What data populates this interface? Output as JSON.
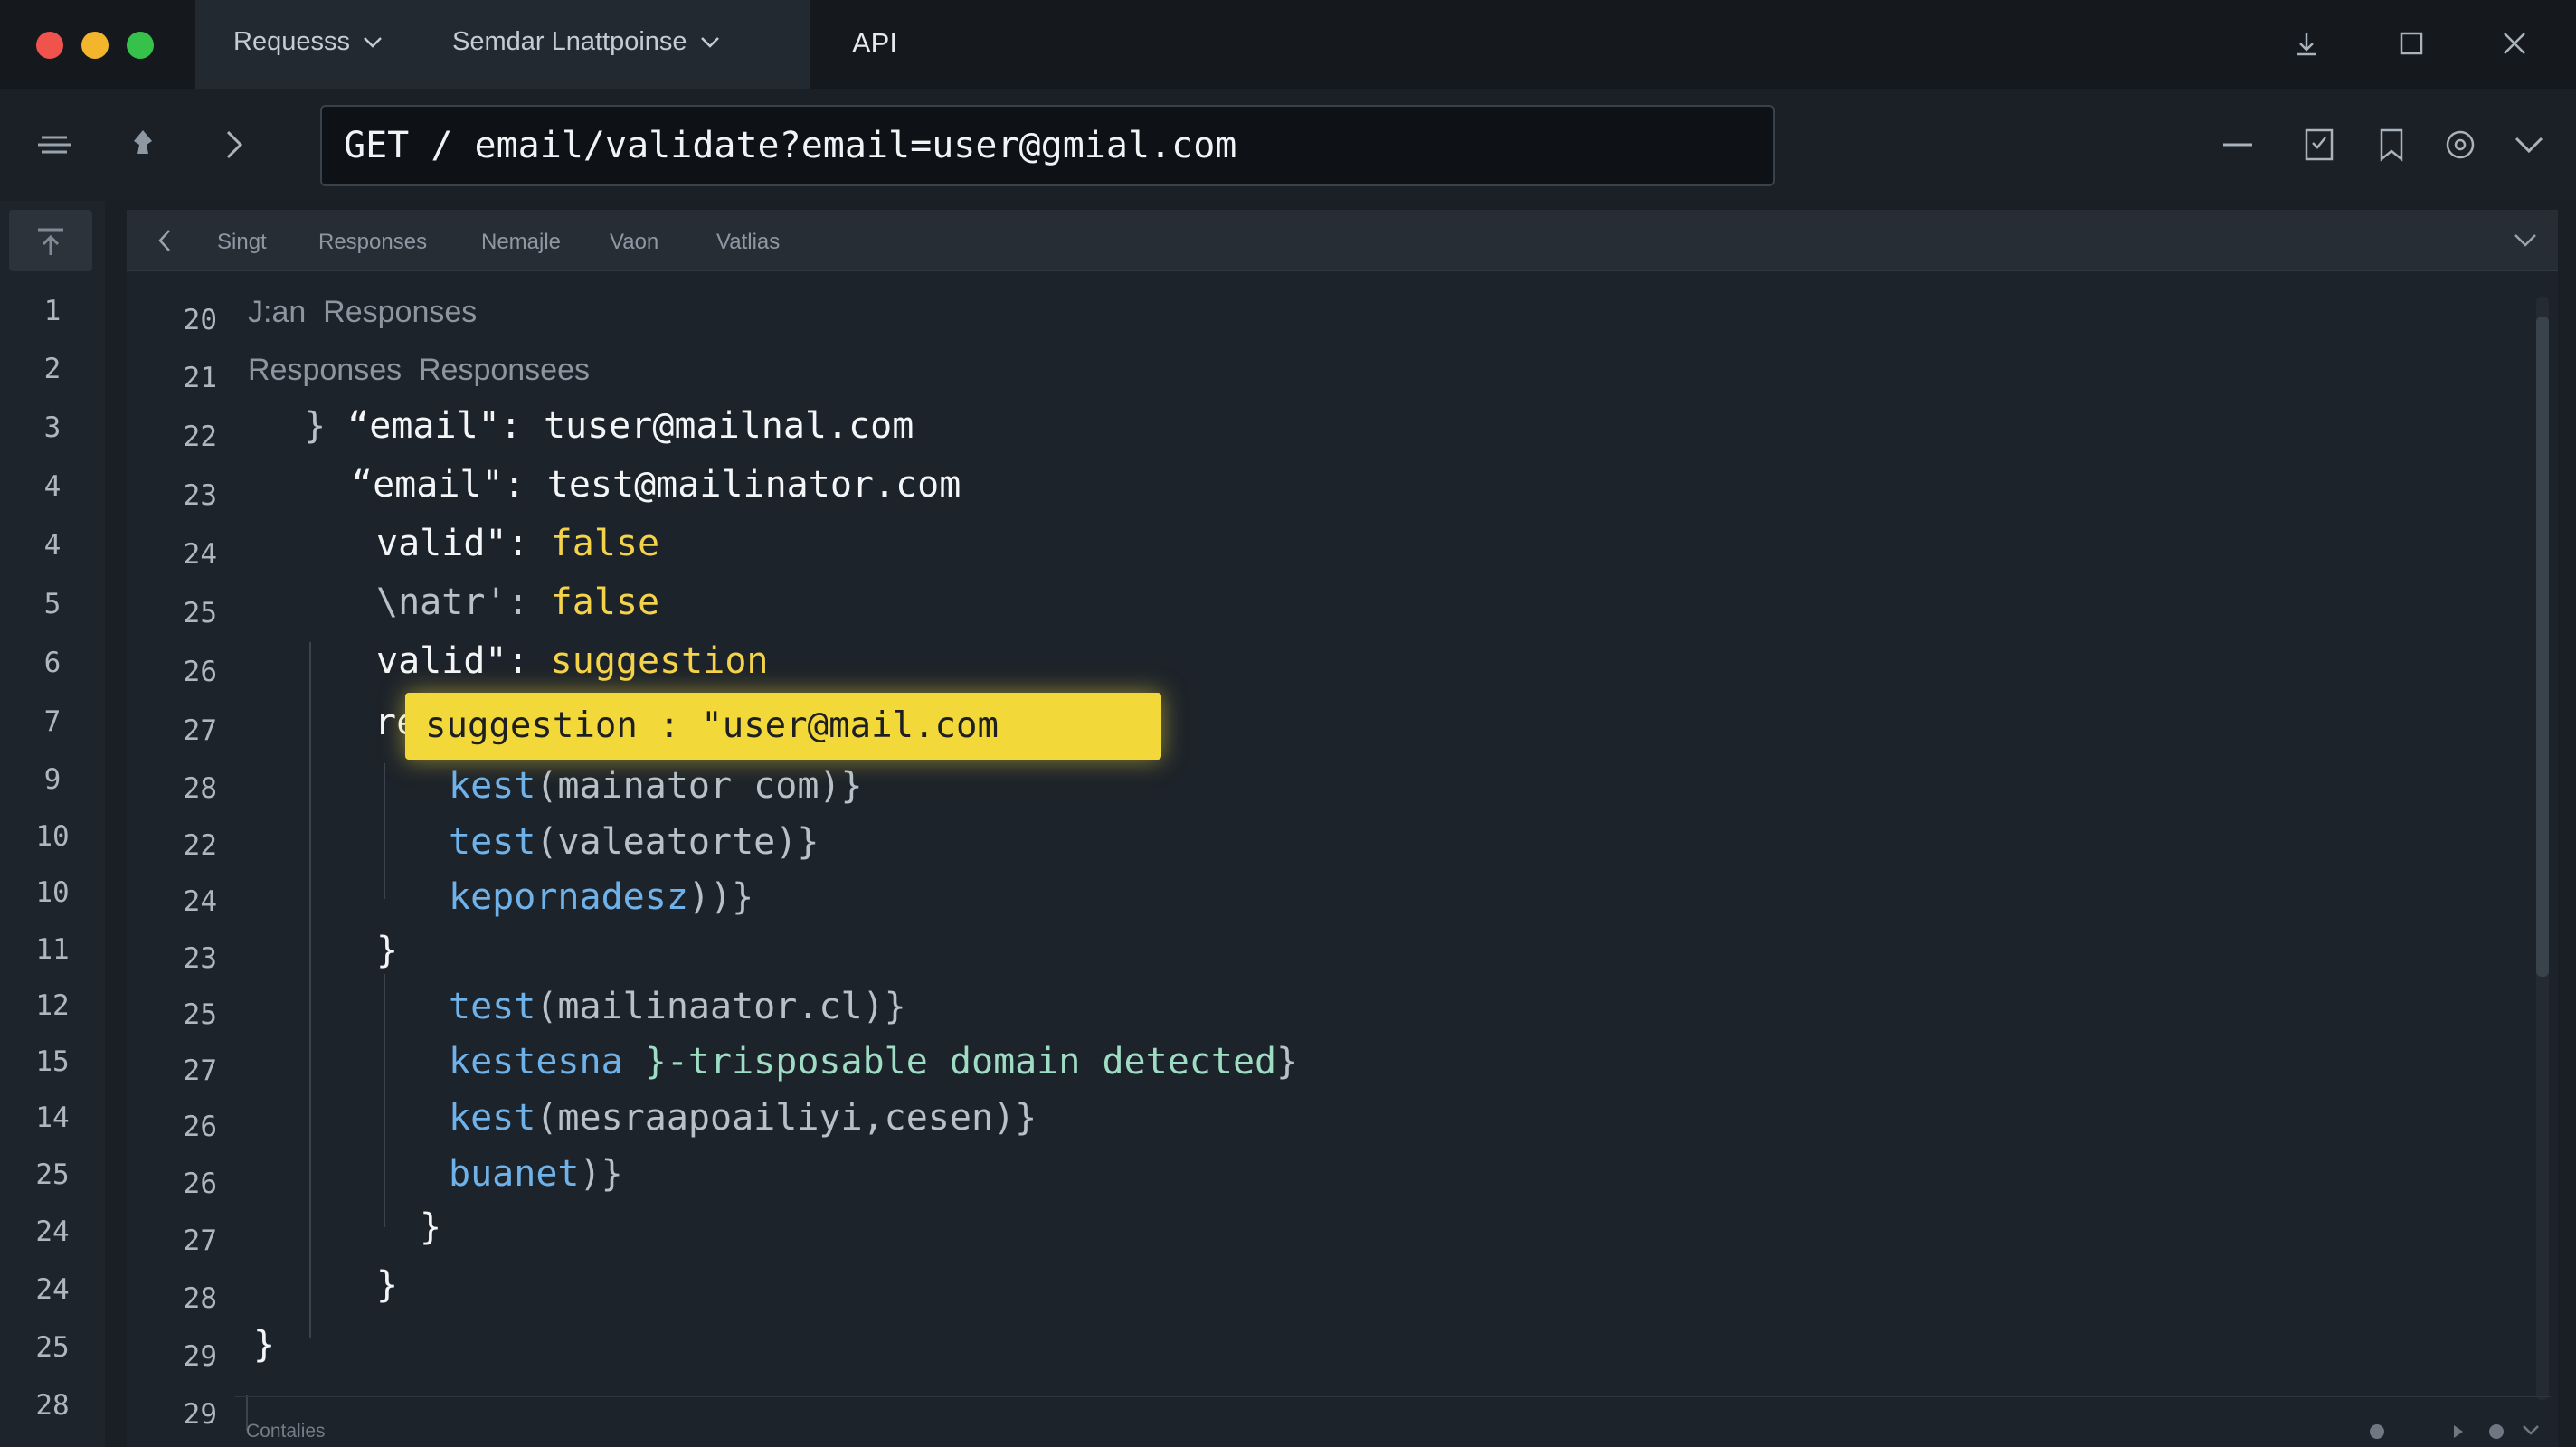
{
  "titlebar": {
    "tabs": [
      {
        "label": "Requesss"
      },
      {
        "label": "Semdar  Lnattpoinse"
      }
    ],
    "api_label": "API"
  },
  "toolbar": {
    "url": "GET / email/validate?email=user@gmial.com"
  },
  "subtabs": [
    "Singt",
    "Responses",
    "Nemajle",
    "Vaon",
    "Vatlias"
  ],
  "gutter_numbers": [
    "1",
    "2",
    "3",
    "4",
    "4",
    "5",
    "6",
    "7",
    "9",
    "10",
    "10",
    "11",
    "12",
    "15",
    "14",
    "25",
    "24",
    "24",
    "25",
    "28"
  ],
  "code_numbers": [
    "20",
    "21",
    "22",
    "23",
    "24",
    "25",
    "26",
    "27",
    "28",
    "22",
    "24",
    "23",
    "25",
    "27",
    "26",
    "26",
    "27",
    "28",
    "29",
    "29"
  ],
  "code": {
    "l0": "J:an  Responses",
    "l1": "Responses  Responsees",
    "l2_brace": "}",
    "l2_key": "“email\": ",
    "l2_val": "tuser@mailnal.com",
    "l3_key": "“email\": ",
    "l3_val": "test@mailinator.com",
    "l4_key": "valid\": ",
    "l4_val": "false",
    "l5_key": "\\natr': ",
    "l5_val": "false",
    "l6_key": "valid\": ",
    "l6_val": "suggestion",
    "l7_key": "reason",
    "l7_highlight": "suggestion : \"user@mail.com",
    "l8_fn": "kest",
    "l8_args": "(mainator com)}",
    "l9_fn": "test",
    "l9_args": "(valeatorte)}",
    "l10_fn": "kepornadesz",
    "l10_args": "))}",
    "l11": "}",
    "l12_fn": "test",
    "l12_args": "(mailinaator.cl)}",
    "l13_fn": "kestesna ",
    "l13_msg": "}-trisposable domain detected",
    "l13_end": "}",
    "l14_fn": "kest",
    "l14_args": "(mesraapoailiyi,cesen)}",
    "l15_fn": "buanet",
    "l15_args": ")}",
    "l16": "}",
    "l17": "}",
    "l18": "}"
  },
  "status": {
    "text": "Contalies"
  },
  "colors": {
    "highlight": "#f3d83a",
    "keyword_blue": "#6fb2ea",
    "value_yellow": "#f4d34a",
    "message_green": "#9fdcc4"
  }
}
